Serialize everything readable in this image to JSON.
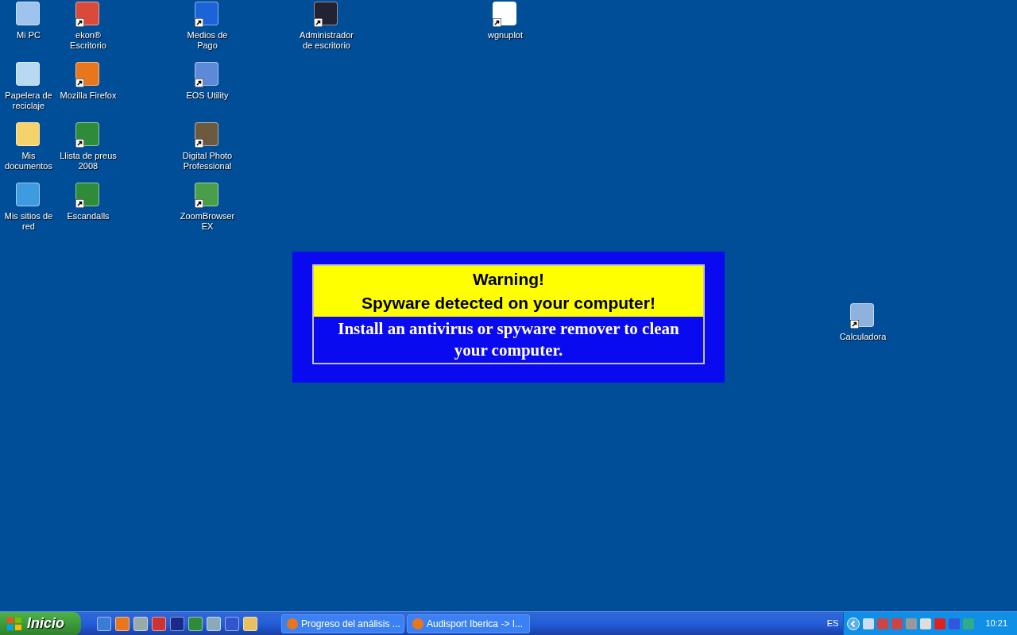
{
  "desktop_icons": [
    {
      "label": "Mi PC",
      "shortcut": false
    },
    {
      "label": "ekon® Escritorio",
      "shortcut": true
    },
    {
      "label": "Medios de Pago",
      "shortcut": true
    },
    {
      "label": "Administrador de escritorio",
      "shortcut": true
    },
    {
      "label": "wgnuplot",
      "shortcut": true
    },
    {
      "label": "Papelera de reciclaje",
      "shortcut": false
    },
    {
      "label": "Mozilla Firefox",
      "shortcut": true
    },
    {
      "label": "EOS Utility",
      "shortcut": true
    },
    {
      "label": "Mis documentos",
      "shortcut": false
    },
    {
      "label": "Llista de preus 2008",
      "shortcut": true
    },
    {
      "label": "Digital Photo Professional",
      "shortcut": true
    },
    {
      "label": "Mis sitios de red",
      "shortcut": false
    },
    {
      "label": "Escandalls",
      "shortcut": true
    },
    {
      "label": "ZoomBrowser EX",
      "shortcut": true
    },
    {
      "label": "Calculadora",
      "shortcut": true
    }
  ],
  "warning": {
    "title": "Warning!",
    "headline": "Spyware detected on your computer!",
    "message": "Install an antivirus or spyware remover to clean your computer."
  },
  "taskbar": {
    "start_label": "Inicio",
    "tasks": [
      {
        "label": "Progreso del análisis ...",
        "selected": false
      },
      {
        "label": "Audisport Iberica -> I...",
        "selected": false
      }
    ],
    "language": "ES",
    "clock": "10:21"
  }
}
